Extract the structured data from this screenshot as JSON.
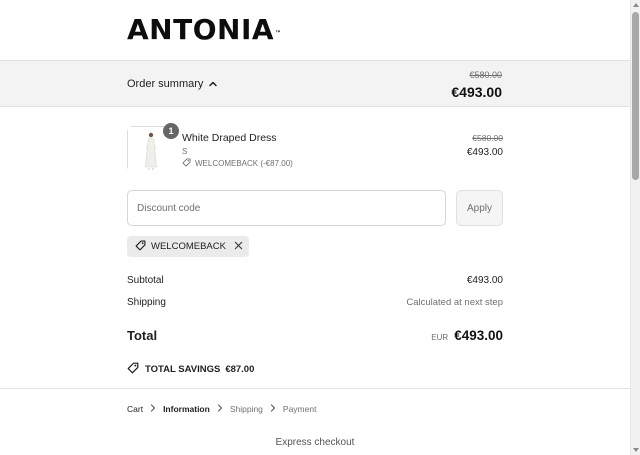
{
  "brand": {
    "logo_text": "ANTONIA",
    "trademark": "™"
  },
  "summary": {
    "toggle_label": "Order summary",
    "compare_price": "€580.00",
    "total": "€493.00"
  },
  "item": {
    "quantity": "1",
    "name": "White Draped Dress",
    "variant": "S",
    "discount_note": "WELCOMEBACK (-€87.00)",
    "compare_price": "€580.00",
    "price": "€493.00"
  },
  "discount": {
    "placeholder": "Discount code",
    "apply_label": "Apply",
    "applied_code": "WELCOMEBACK"
  },
  "totals": {
    "subtotal_label": "Subtotal",
    "subtotal_value": "€493.00",
    "shipping_label": "Shipping",
    "shipping_value": "Calculated at next step",
    "total_label": "Total",
    "currency": "EUR",
    "total_value": "€493.00",
    "savings_label": "TOTAL SAVINGS",
    "savings_value": "€87.00"
  },
  "breadcrumb": [
    {
      "label": "Cart",
      "state": "done"
    },
    {
      "label": "Information",
      "state": "current"
    },
    {
      "label": "Shipping",
      "state": "pending"
    },
    {
      "label": "Payment",
      "state": "pending"
    }
  ],
  "express_label": "Express checkout",
  "icons": {
    "summary_chevron": "chevron-up-icon",
    "tag": "tag-icon",
    "close": "close-icon",
    "breadcrumb_sep": "chevron-right-icon"
  },
  "colors": {
    "summary_bar_bg": "#f3f3f3",
    "badge": "#666666",
    "muted": "#707070",
    "chip_bg": "#ebebeb"
  }
}
